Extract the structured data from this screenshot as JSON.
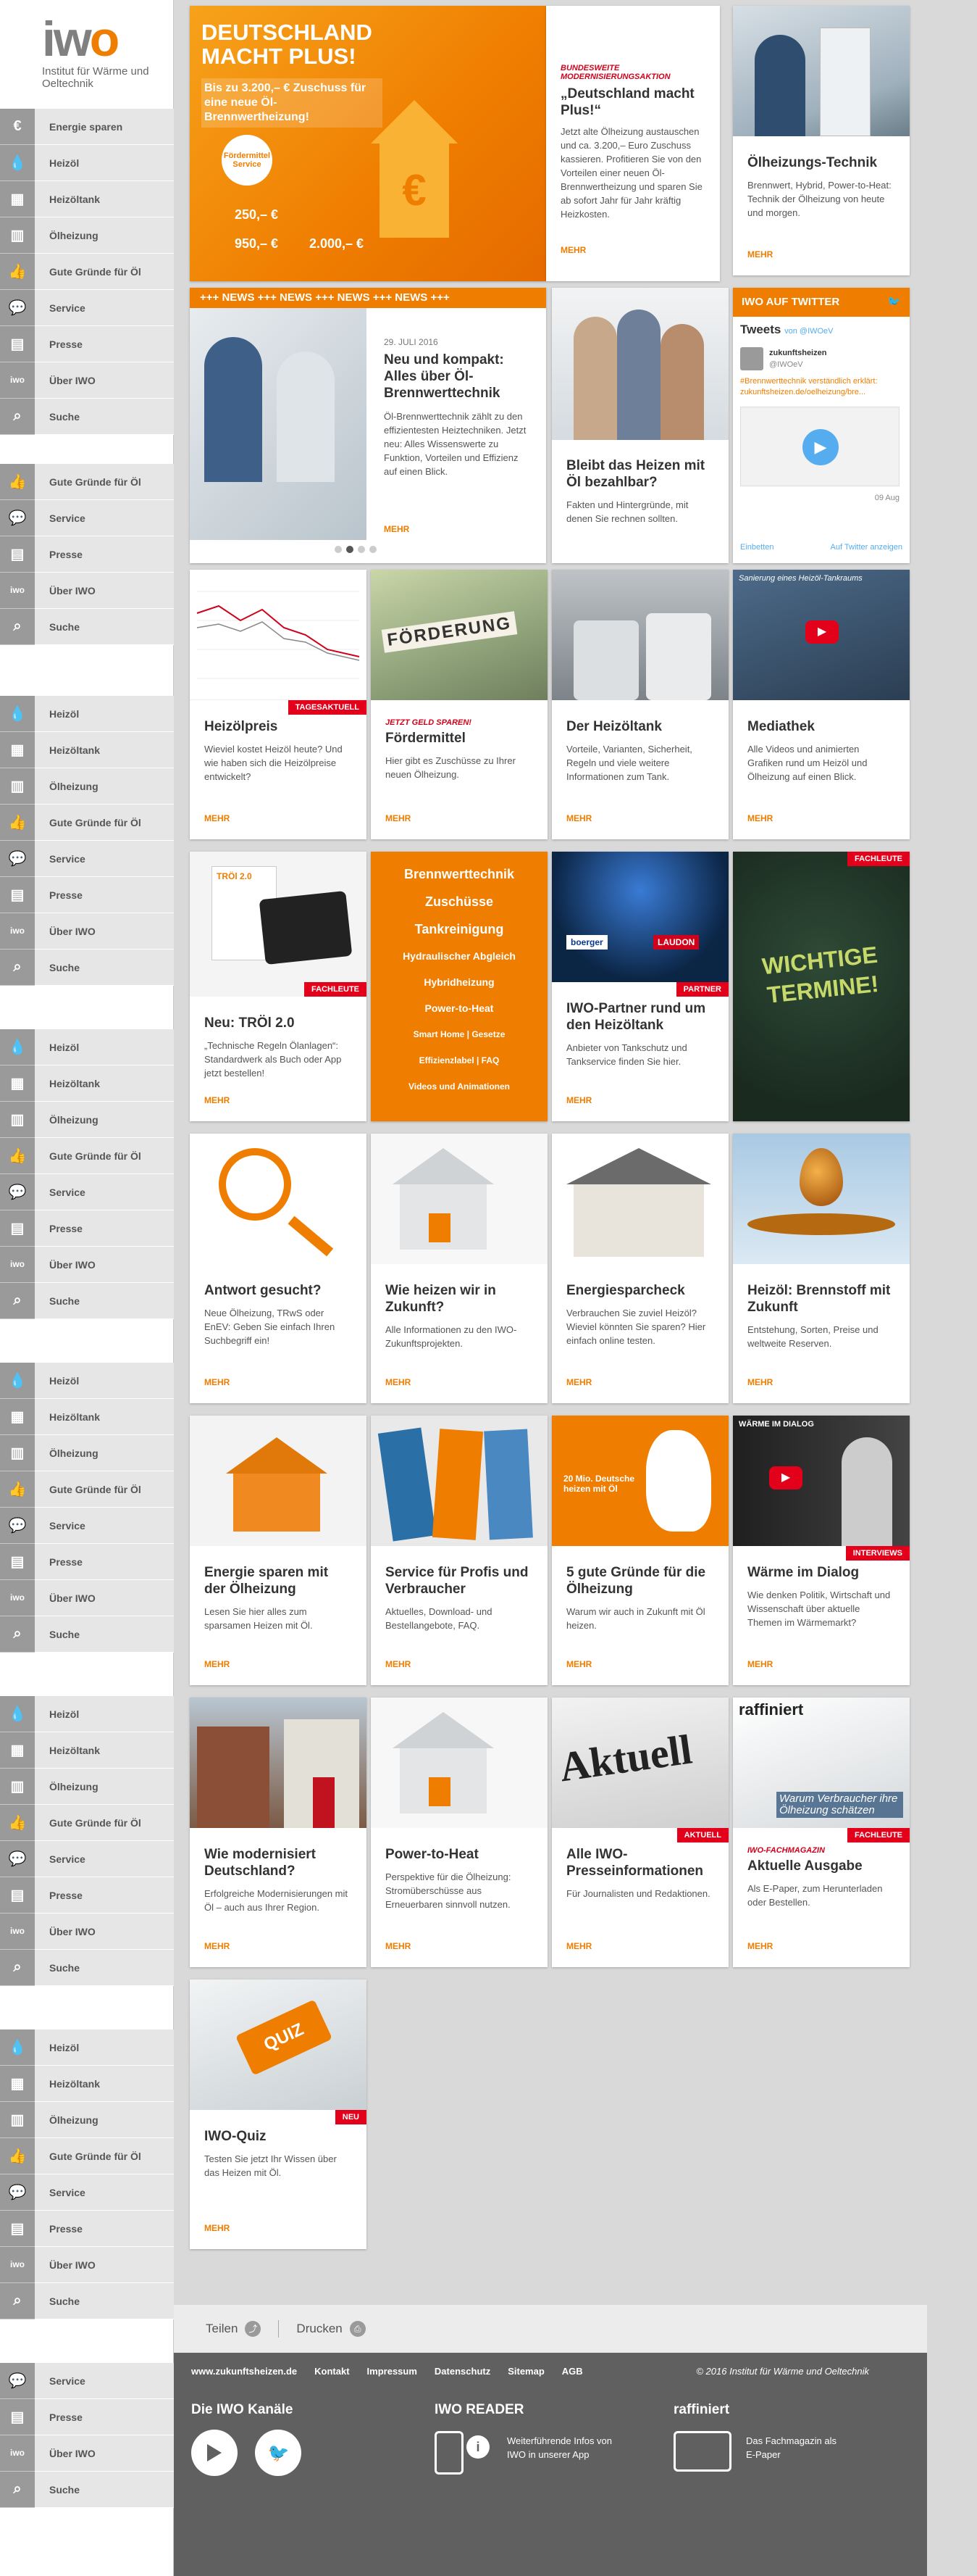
{
  "logo": {
    "mark_a": "iw",
    "mark_b": "o",
    "subtitle": "Institut für Wärme und Oeltechnik"
  },
  "nav_groups": [
    {
      "items": [
        {
          "icon": "euro-icon",
          "glyph": "€",
          "label": "Energie sparen"
        },
        {
          "icon": "drop-icon",
          "glyph": "💧",
          "label": "Heizöl"
        },
        {
          "icon": "tank-icon",
          "glyph": "▦",
          "label": "Heizöltank"
        },
        {
          "icon": "heater-icon",
          "glyph": "▥",
          "label": "Ölheizung"
        },
        {
          "icon": "thumbs-up-icon",
          "glyph": "👍",
          "label": "Gute Gründe für Öl"
        },
        {
          "icon": "chat-icon",
          "glyph": "💬",
          "label": "Service"
        },
        {
          "icon": "newspaper-icon",
          "glyph": "▤",
          "label": "Presse"
        },
        {
          "icon": "iwo-icon",
          "glyph": "iwo",
          "label": "Über IWO"
        },
        {
          "icon": "search-icon",
          "glyph": "⌕",
          "label": "Suche"
        }
      ]
    },
    {
      "items": [
        {
          "icon": "thumbs-up-icon",
          "glyph": "👍",
          "label": "Gute Gründe für Öl"
        },
        {
          "icon": "chat-icon",
          "glyph": "💬",
          "label": "Service"
        },
        {
          "icon": "newspaper-icon",
          "glyph": "▤",
          "label": "Presse"
        },
        {
          "icon": "iwo-icon",
          "glyph": "iwo",
          "label": "Über IWO"
        },
        {
          "icon": "search-icon",
          "glyph": "⌕",
          "label": "Suche"
        }
      ]
    },
    {
      "items": [
        {
          "icon": "drop-icon",
          "glyph": "💧",
          "label": "Heizöl"
        },
        {
          "icon": "tank-icon",
          "glyph": "▦",
          "label": "Heizöltank"
        },
        {
          "icon": "heater-icon",
          "glyph": "▥",
          "label": "Ölheizung"
        },
        {
          "icon": "thumbs-up-icon",
          "glyph": "👍",
          "label": "Gute Gründe für Öl"
        },
        {
          "icon": "chat-icon",
          "glyph": "💬",
          "label": "Service"
        },
        {
          "icon": "newspaper-icon",
          "glyph": "▤",
          "label": "Presse"
        },
        {
          "icon": "iwo-icon",
          "glyph": "iwo",
          "label": "Über IWO"
        },
        {
          "icon": "search-icon",
          "glyph": "⌕",
          "label": "Suche"
        }
      ]
    },
    {
      "items": [
        {
          "icon": "drop-icon",
          "glyph": "💧",
          "label": "Heizöl"
        },
        {
          "icon": "tank-icon",
          "glyph": "▦",
          "label": "Heizöltank"
        },
        {
          "icon": "heater-icon",
          "glyph": "▥",
          "label": "Ölheizung"
        },
        {
          "icon": "thumbs-up-icon",
          "glyph": "👍",
          "label": "Gute Gründe für Öl"
        },
        {
          "icon": "chat-icon",
          "glyph": "💬",
          "label": "Service"
        },
        {
          "icon": "newspaper-icon",
          "glyph": "▤",
          "label": "Presse"
        },
        {
          "icon": "iwo-icon",
          "glyph": "iwo",
          "label": "Über IWO"
        },
        {
          "icon": "search-icon",
          "glyph": "⌕",
          "label": "Suche"
        }
      ]
    },
    {
      "items": [
        {
          "icon": "drop-icon",
          "glyph": "💧",
          "label": "Heizöl"
        },
        {
          "icon": "tank-icon",
          "glyph": "▦",
          "label": "Heizöltank"
        },
        {
          "icon": "heater-icon",
          "glyph": "▥",
          "label": "Ölheizung"
        },
        {
          "icon": "thumbs-up-icon",
          "glyph": "👍",
          "label": "Gute Gründe für Öl"
        },
        {
          "icon": "chat-icon",
          "glyph": "💬",
          "label": "Service"
        },
        {
          "icon": "newspaper-icon",
          "glyph": "▤",
          "label": "Presse"
        },
        {
          "icon": "iwo-icon",
          "glyph": "iwo",
          "label": "Über IWO"
        },
        {
          "icon": "search-icon",
          "glyph": "⌕",
          "label": "Suche"
        }
      ]
    },
    {
      "items": [
        {
          "icon": "drop-icon",
          "glyph": "💧",
          "label": "Heizöl"
        },
        {
          "icon": "tank-icon",
          "glyph": "▦",
          "label": "Heizöltank"
        },
        {
          "icon": "heater-icon",
          "glyph": "▥",
          "label": "Ölheizung"
        },
        {
          "icon": "thumbs-up-icon",
          "glyph": "👍",
          "label": "Gute Gründe für Öl"
        },
        {
          "icon": "chat-icon",
          "glyph": "💬",
          "label": "Service"
        },
        {
          "icon": "newspaper-icon",
          "glyph": "▤",
          "label": "Presse"
        },
        {
          "icon": "iwo-icon",
          "glyph": "iwo",
          "label": "Über IWO"
        },
        {
          "icon": "search-icon",
          "glyph": "⌕",
          "label": "Suche"
        }
      ]
    },
    {
      "items": [
        {
          "icon": "drop-icon",
          "glyph": "💧",
          "label": "Heizöl"
        },
        {
          "icon": "tank-icon",
          "glyph": "▦",
          "label": "Heizöltank"
        },
        {
          "icon": "heater-icon",
          "glyph": "▥",
          "label": "Ölheizung"
        },
        {
          "icon": "thumbs-up-icon",
          "glyph": "👍",
          "label": "Gute Gründe für Öl"
        },
        {
          "icon": "chat-icon",
          "glyph": "💬",
          "label": "Service"
        },
        {
          "icon": "newspaper-icon",
          "glyph": "▤",
          "label": "Presse"
        },
        {
          "icon": "iwo-icon",
          "glyph": "iwo",
          "label": "Über IWO"
        },
        {
          "icon": "search-icon",
          "glyph": "⌕",
          "label": "Suche"
        }
      ]
    },
    {
      "items": [
        {
          "icon": "chat-icon",
          "glyph": "💬",
          "label": "Service"
        },
        {
          "icon": "newspaper-icon",
          "glyph": "▤",
          "label": "Presse"
        },
        {
          "icon": "iwo-icon",
          "glyph": "iwo",
          "label": "Über IWO"
        },
        {
          "icon": "search-icon",
          "glyph": "⌕",
          "label": "Suche"
        }
      ]
    }
  ],
  "hero": {
    "headline": "DEUTSCHLAND MACHT PLUS!",
    "subline": "Bis zu 3.200,– € Zuschuss für eine neue Öl-Brennwertheizung!",
    "badge": "Fördermittel Service",
    "amounts": [
      "250,– €",
      "950,– €",
      "2.000,– €"
    ],
    "kicker": "BUNDESWEITE MODERNISIERUNGSAKTION",
    "title": "„Deutschland macht Plus!“",
    "text": "Jetzt alte Ölheizung austauschen und ca. 3.200,– Euro Zuschuss kassieren. Profitieren Sie von den Vorteilen einer neuen Öl-Brennwertheizung und sparen Sie ab sofort Jahr für Jahr kräftig Heizkosten.",
    "more": "MEHR"
  },
  "tile_oelheizung": {
    "title": "Ölheizungs-Technik",
    "text": "Brennwert, Hybrid, Power-to-Heat: Technik der Ölheizung von heute und morgen.",
    "more": "MEHR"
  },
  "news": {
    "banner": "+++ NEWS +++ NEWS +++ NEWS +++ NEWS +++",
    "date": "29. JULI 2016",
    "title": "Neu und kompakt: Alles über Öl-Brennwerttechnik",
    "text": "Öl-Brennwerttechnik zählt zu den effizientesten Heiztechniken. Jetzt neu: Alles Wissenswerte zu Funktion, Vorteilen und Effizienz auf einen Blick.",
    "more": "MEHR"
  },
  "tile_bezahlbar": {
    "title": "Bleibt das Heizen mit Öl bezahlbar?",
    "text": "Fakten und Hintergründe, mit denen Sie rechnen sollten."
  },
  "twitter": {
    "header": "IWO AUF TWITTER",
    "tweets_label": "Tweets",
    "tweets_by": "von @IWOeV",
    "account_name": "zukunftsheizen",
    "account_handle": "@IWOeV",
    "tweet_text": "#Brennwerttechnik verständlich erklärt: zukunftsheizen.de/oelheizung/bre...",
    "tweet_date": "09 Aug",
    "embed_label": "Einbetten",
    "view_label": "Auf Twitter anzeigen"
  },
  "tiles_row3": [
    {
      "badge": "TAGESAKTUELL",
      "kicker": "",
      "title": "Heizölpreis",
      "text": "Wieviel kostet Heizöl heute? Und wie haben sich die Heizölpreise entwickelt?",
      "more": "MEHR"
    },
    {
      "badge": "",
      "kicker": "JETZT GELD SPAREN!",
      "title": "Fördermittel",
      "text": "Hier gibt es Zuschüsse zu Ihrer neuen Ölheizung.",
      "more": "MEHR",
      "img_word": "FÖRDERUNG"
    },
    {
      "badge": "",
      "kicker": "",
      "title": "Der Heizöltank",
      "text": "Vorteile, Varianten, Sicherheit, Regeln und viele weitere Informationen zum Tank.",
      "more": "MEHR"
    },
    {
      "badge": "",
      "kicker": "",
      "title": "Mediathek",
      "text": "Alle Videos und animierten Grafiken rund um Heizöl und Ölheizung auf einen Blick.",
      "more": "MEHR",
      "img_caption": "Sanierung eines Heizöl-Tankraums"
    }
  ],
  "tile_troel": {
    "badge": "FACHLEUTE",
    "title": "Neu: TRÖl 2.0",
    "text": "„Technische Regeln Ölanlagen“: Standardwerk als Buch oder App jetzt bestellen!",
    "more": "MEHR",
    "img_label": "TRÖl 2.0"
  },
  "link_tile": {
    "links": [
      "Brennwerttechnik",
      "Zuschüsse",
      "Tankreinigung",
      "Hydraulischer Abgleich",
      "Hybridheizung",
      "Power-to-Heat",
      "Smart Home | Gesetze",
      "Effizienzlabel | FAQ",
      "Videos und Animationen"
    ]
  },
  "tile_partner": {
    "badge": "PARTNER",
    "title": "IWO-Partner rund um den Heizöltank",
    "text": "Anbieter von Tankschutz und Tankservice finden Sie hier.",
    "more": "MEHR",
    "logos": [
      "boerger",
      "LAUDON"
    ]
  },
  "tile_termine": {
    "badge": "FACHLEUTE",
    "text": "WICHTIGE TERMINE!"
  },
  "tiles_row5": [
    {
      "title": "Antwort gesucht?",
      "text": "Neue Ölheizung, TRwS oder EnEV: Geben Sie einfach Ihren Suchbegriff ein!",
      "more": "MEHR"
    },
    {
      "title": "Wie heizen wir in Zukunft?",
      "text": "Alle Informationen zu den IWO-Zukunftsprojekten.",
      "more": "MEHR"
    },
    {
      "title": "Energiesparcheck",
      "text": "Verbrauchen Sie zuviel Heizöl? Wieviel könnten Sie sparen? Hier einfach online testen.",
      "more": "MEHR"
    },
    {
      "title": "Heizöl: Brennstoff mit Zukunft",
      "text": "Entstehung, Sorten, Preise und weltweite Reserven.",
      "more": "MEHR"
    }
  ],
  "tiles_row6": [
    {
      "badge": "",
      "title": "Energie sparen mit der Ölheizung",
      "text": "Lesen Sie hier alles zum sparsamen Heizen mit Öl.",
      "more": "MEHR"
    },
    {
      "badge": "",
      "title": "Service für Profis und Verbraucher",
      "text": "Aktuelles, Download- und Bestellangebote, FAQ.",
      "more": "MEHR"
    },
    {
      "badge": "",
      "title": "5 gute Gründe für die Ölheizung",
      "text": "Warum wir auch in Zukunft mit Öl heizen.",
      "more": "MEHR",
      "img_text": "20 Mio. Deutsche heizen mit Öl"
    },
    {
      "badge": "INTERVIEWS",
      "title": "Wärme im Dialog",
      "text": "Wie denken Politik, Wirtschaft und Wissenschaft über aktuelle Themen im Wärmemarkt?",
      "more": "MEHR",
      "img_caption": "WÄRME IM DIALOG"
    }
  ],
  "tiles_row7": [
    {
      "badge": "",
      "kicker": "",
      "title": "Wie modernisiert Deutschland?",
      "text": "Erfolgreiche Modernisierungen mit Öl – auch aus Ihrer Region.",
      "more": "MEHR"
    },
    {
      "badge": "",
      "kicker": "",
      "title": "Power-to-Heat",
      "text": "Perspektive für die Ölheizung: Stromüberschüsse aus Erneuerbaren sinnvoll nutzen.",
      "more": "MEHR"
    },
    {
      "badge": "AKTUELL",
      "kicker": "",
      "title": "Alle IWO-Presseinformationen",
      "text": "Für Journalisten und Redaktionen.",
      "more": "MEHR",
      "img_word": "Aktuell"
    },
    {
      "badge": "FACHLEUTE",
      "kicker": "IWO-FACHMAGAZIN",
      "title": "Aktuelle Ausgabe",
      "text": "Als E-Paper, zum Herunterladen oder Bestellen.",
      "more": "MEHR",
      "img_word": "raffiniert",
      "img_caption": "Warum Verbraucher ihre Ölheizung schätzen"
    }
  ],
  "tile_quiz": {
    "badge": "NEU",
    "title": "IWO-Quiz",
    "text": "Testen Sie jetzt Ihr Wissen über das Heizen mit Öl.",
    "more": "MEHR",
    "img_word": "QUIZ"
  },
  "share": {
    "share_label": "Teilen",
    "print_label": "Drucken"
  },
  "footer": {
    "links": [
      "www.zukunftsheizen.de",
      "Kontakt",
      "Impressum",
      "Datenschutz",
      "Sitemap",
      "AGB"
    ],
    "copyright": "© 2016 Institut für Wärme und Oeltechnik",
    "channels_title": "Die IWO Kanäle",
    "reader_title": "IWO READER",
    "reader_text": "Weiterführende Infos von IWO in unserer App",
    "raffiniert_title": "raffiniert",
    "raffiniert_text": "Das Fachmagazin als E-Paper"
  },
  "colors": {
    "accent": "#ef7d00",
    "badge": "#e2001a",
    "footer": "#606060",
    "twitter": "#55acee"
  }
}
